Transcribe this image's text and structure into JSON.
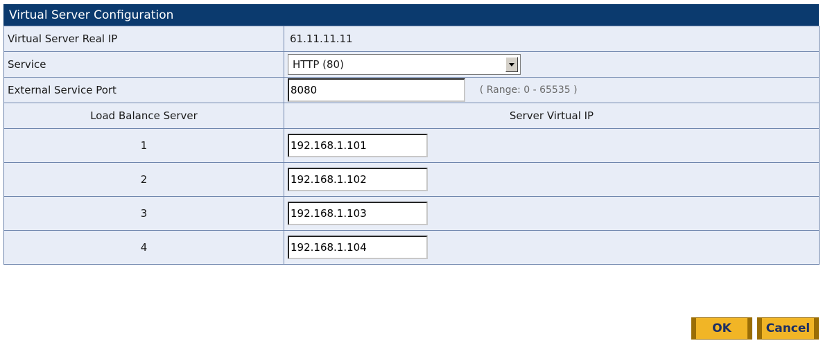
{
  "panel": {
    "title": "Virtual Server Configuration"
  },
  "real_ip": {
    "label": "Virtual Server Real IP",
    "value": "61.11.11.11"
  },
  "service": {
    "label": "Service",
    "selected": "HTTP (80)"
  },
  "external_port": {
    "label": "External Service Port",
    "value": "8080",
    "range_hint": "( Range: 0 - 65535 )"
  },
  "balance_table": {
    "col_server": "Load Balance Server",
    "col_ip": "Server Virtual IP",
    "rows": [
      {
        "index": "1",
        "ip": "192.168.1.101"
      },
      {
        "index": "2",
        "ip": "192.168.1.102"
      },
      {
        "index": "3",
        "ip": "192.168.1.103"
      },
      {
        "index": "4",
        "ip": "192.168.1.104"
      }
    ]
  },
  "buttons": {
    "ok": "OK",
    "cancel": "Cancel"
  },
  "colors": {
    "title_bg": "#0b3a6e",
    "table_bg": "#e8edf7",
    "button_bg": "#f1b526",
    "button_text": "#1c2f64"
  }
}
